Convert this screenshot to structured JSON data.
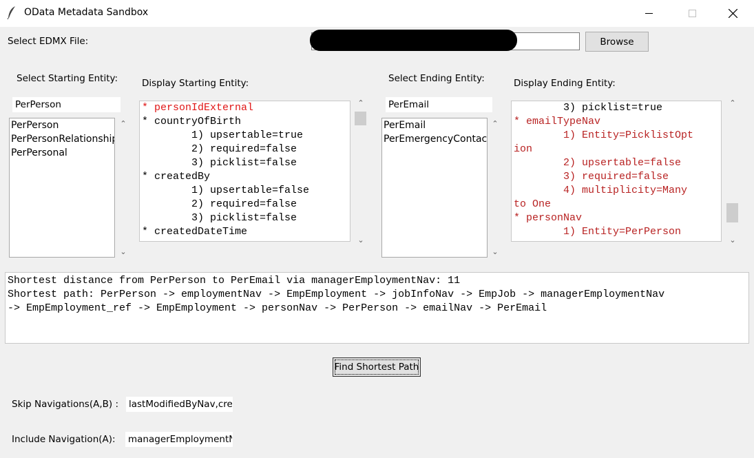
{
  "window": {
    "title": "OData Metadata Sandbox"
  },
  "edmx": {
    "label": "Select EDMX File:",
    "browse_label": "Browse",
    "file_path": ""
  },
  "start": {
    "select_label": "Select Starting Entity:",
    "display_label": "Display Starting Entity:",
    "search_value": "PerPerson",
    "list": [
      "PerPerson",
      "PerPersonRelationship",
      "PerPersonal"
    ],
    "lines": [
      "* personIdExternal",
      "* countryOfBirth",
      "        1) upsertable=true",
      "        2) required=false",
      "        3) picklist=false",
      "* createdBy",
      "        1) upsertable=false",
      "        2) required=false",
      "        3) picklist=false",
      "* createdDateTime"
    ]
  },
  "end": {
    "select_label": "Select Ending Entity:",
    "display_label": "Display Ending Entity:",
    "search_value": "PerEmail",
    "list": [
      "PerEmail",
      "PerEmergencyContact:"
    ],
    "lines": [
      "        3) picklist=true",
      "* emailTypeNav",
      "        1) Entity=PicklistOpt",
      "ion",
      "        2) upsertable=false",
      "        3) required=false",
      "        4) multiplicity=Many",
      "to One",
      "* personNav",
      "        1) Entity=PerPerson"
    ]
  },
  "output": {
    "lines": [
      "Shortest distance from PerPerson to PerEmail via managerEmploymentNav: 11",
      "Shortest path: PerPerson -> employmentNav -> EmpEmployment -> jobInfoNav -> EmpJob -> managerEmploymentNav",
      "-> EmpEmployment_ref -> EmpEmployment -> personNav -> PerPerson -> emailNav -> PerEmail"
    ]
  },
  "find_button_label": "Find Shortest Path",
  "skip": {
    "label": "Skip Navigations(A,B) :",
    "value": "lastModifiedByNav,crea"
  },
  "include": {
    "label": "Include Navigation(A):",
    "value": "managerEmploymentN"
  },
  "colors": {
    "red": "#e01515",
    "dark_red": "#b82222",
    "background": "#f0f0f0"
  }
}
